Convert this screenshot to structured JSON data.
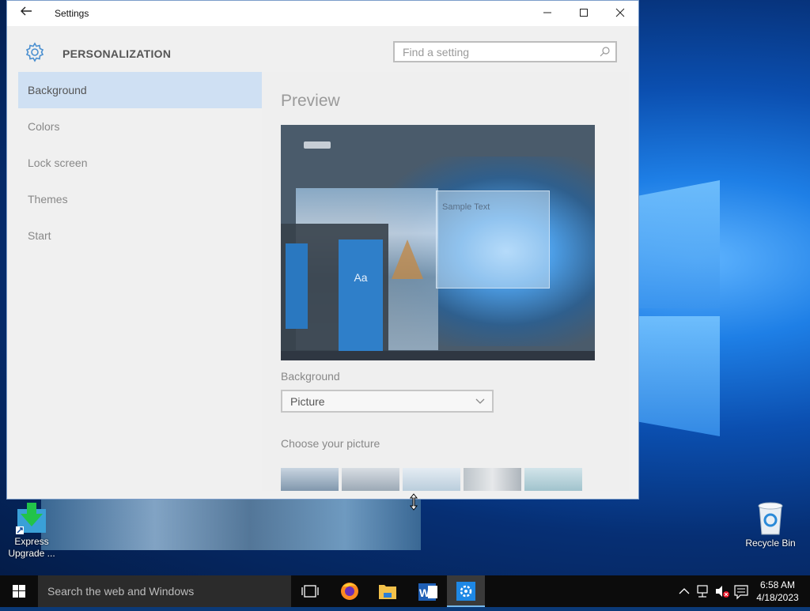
{
  "window": {
    "title": "Settings",
    "back_icon": "back-arrow-icon",
    "minimize": "—",
    "maximize": "□",
    "close": "✕"
  },
  "header": {
    "icon": "gear-icon",
    "title": "PERSONALIZATION",
    "search_placeholder": "Find a setting",
    "search_icon": "search-icon"
  },
  "sidebar": {
    "items": [
      {
        "label": "Background",
        "active": true
      },
      {
        "label": "Colors",
        "active": false
      },
      {
        "label": "Lock screen",
        "active": false
      },
      {
        "label": "Themes",
        "active": false
      },
      {
        "label": "Start",
        "active": false
      }
    ]
  },
  "content": {
    "title": "Preview",
    "preview": {
      "sample_text": "Sample Text",
      "tile_text": "Aa"
    },
    "background_label": "Background",
    "background_value": "Picture",
    "choose_label": "Choose your picture"
  },
  "desktop": {
    "icons": [
      {
        "label": "Express Upgrade ...",
        "icon": "download-arrow-icon"
      },
      {
        "label": "Recycle Bin",
        "icon": "recycle-bin-icon"
      }
    ]
  },
  "taskbar": {
    "search_placeholder": "Search the web and Windows",
    "apps": [
      "task-view",
      "firefox",
      "file-explorer",
      "word",
      "settings"
    ],
    "clock": {
      "time": "6:58 AM",
      "date": "4/18/2023"
    }
  },
  "colors": {
    "accent": "#0078d7",
    "selected_nav": "#cfe0f3"
  }
}
